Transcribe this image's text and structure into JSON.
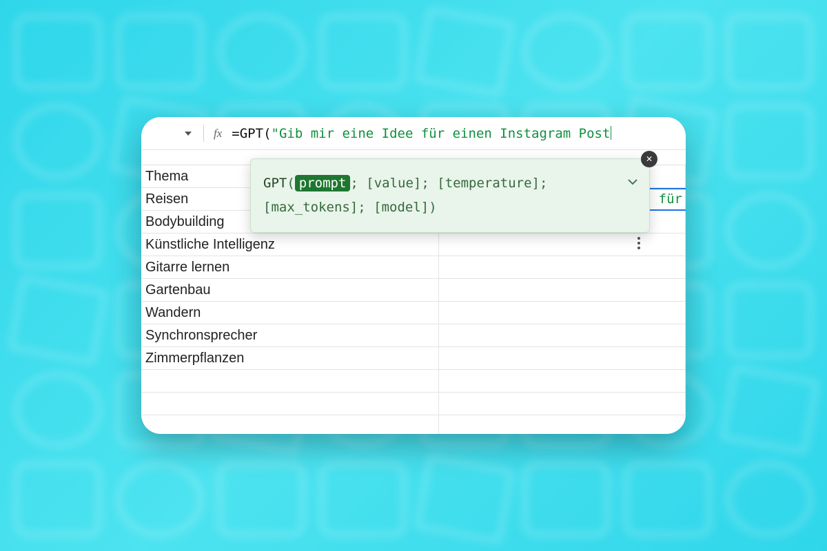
{
  "formula": {
    "prefix_eq": "=",
    "function_name": "GPT",
    "open_paren": "(",
    "string_open": "\"",
    "string_content": "Gib mir eine Idee für einen Instagram Post"
  },
  "tooltip": {
    "function_name": "GPT",
    "open": "(",
    "active_param": "prompt",
    "rest_line1": "; [value]; [temperature];",
    "rest_line2": "[max_tokens]; [model])"
  },
  "active_cell_overflow": "für",
  "column_a": {
    "header": "Thema",
    "rows": [
      "Reisen",
      "Bodybuilding",
      "Künstliche Intelligenz",
      "Gitarre lernen",
      "Gartenbau",
      "Wandern",
      "Synchronsprecher",
      "Zimmerpflanzen"
    ]
  }
}
